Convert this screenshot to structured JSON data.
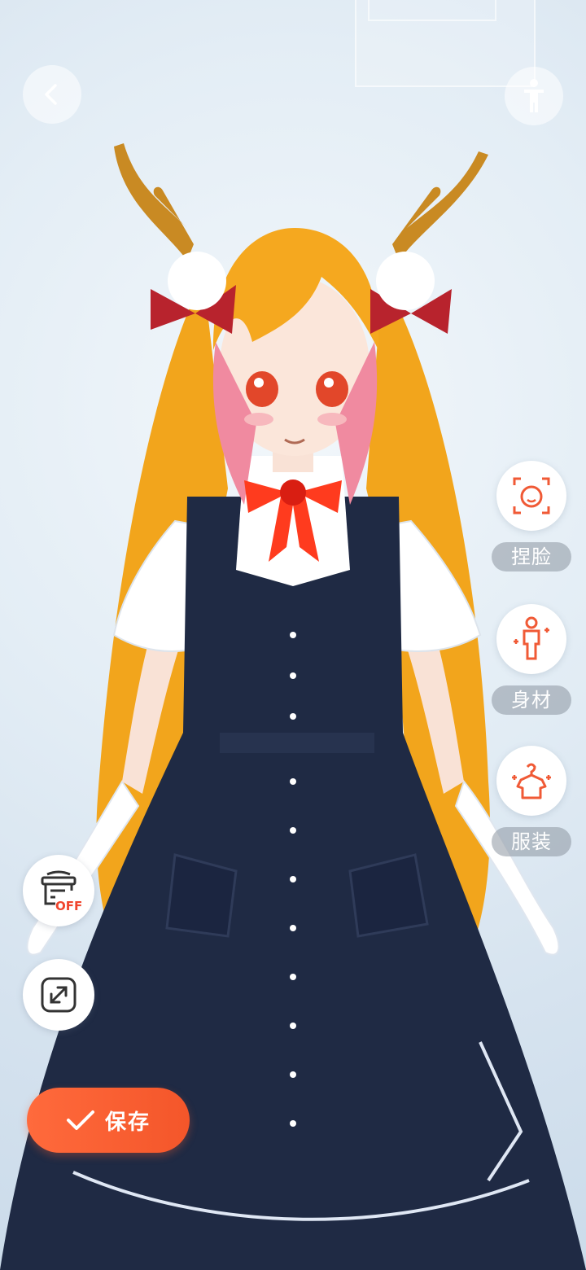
{
  "nav": {
    "back_icon": "chevron-left-icon",
    "body_icon": "person-standing-icon"
  },
  "side_menu": [
    {
      "label": "捏脸",
      "icon": "face-edit-icon"
    },
    {
      "label": "身材",
      "icon": "body-shape-icon"
    },
    {
      "label": "服装",
      "icon": "clothing-hanger-icon"
    }
  ],
  "tools": {
    "background_toggle": {
      "icon": "background-off-icon",
      "badge": "OFF"
    },
    "expand": {
      "icon": "expand-icon"
    }
  },
  "save_button": {
    "label": "保存",
    "icon": "check-icon"
  },
  "colors": {
    "accent": "#f4562a",
    "side_icon": "#f05a36",
    "badge_text": "#f0452d"
  }
}
